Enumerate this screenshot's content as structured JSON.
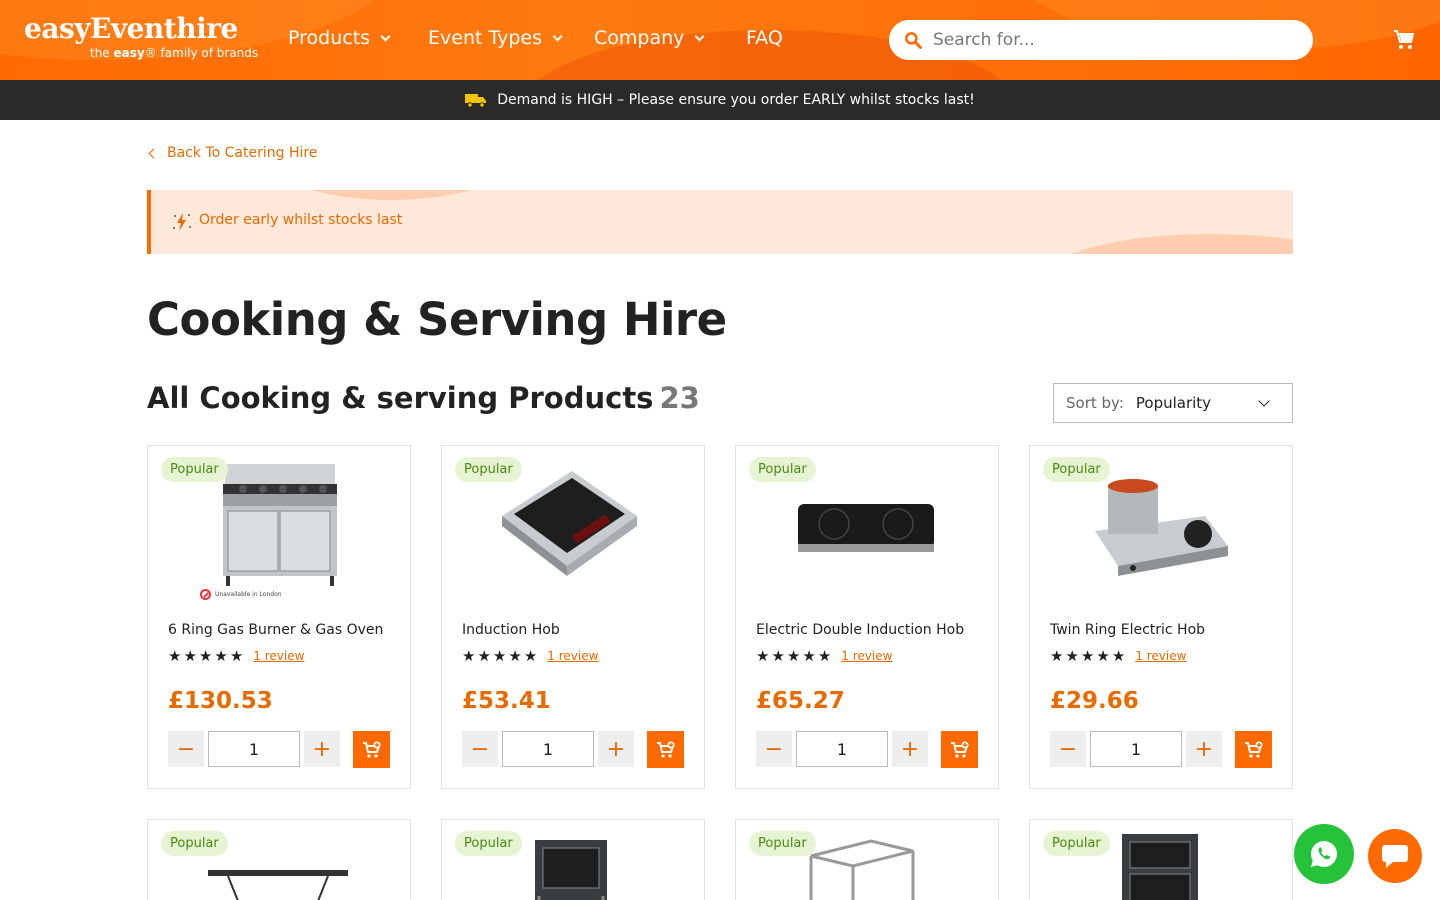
{
  "header": {
    "logo_main": "easyEventhire",
    "logo_sub_prefix": "the",
    "logo_sub_brand": "easy",
    "logo_sub_suffix": "® family of brands",
    "nav": [
      {
        "label": "Products",
        "has_dropdown": true
      },
      {
        "label": "Event Types",
        "has_dropdown": true
      },
      {
        "label": "Company",
        "has_dropdown": true
      },
      {
        "label": "FAQ",
        "has_dropdown": false
      }
    ],
    "search_placeholder": "Search for...",
    "cart_icon": "cart-icon"
  },
  "banner": {
    "text": "Demand is HIGH – Please ensure you order EARLY whilst stocks last!",
    "icon": "truck-icon"
  },
  "back_link": "Back To Catering Hire",
  "alert": {
    "text": "Order early whilst stocks last",
    "icon": "lightning-icon"
  },
  "page_title": "Cooking & Serving Hire",
  "section": {
    "title": "All Cooking & serving Products",
    "count": "23"
  },
  "sort": {
    "label": "Sort by:",
    "value": "Popularity"
  },
  "products": [
    {
      "badge": "Popular",
      "name": "6 Ring Gas Burner & Gas Oven",
      "review": "1 review",
      "price": "£130.53",
      "qty": "1",
      "note": "Unavailable in London",
      "rating": 5
    },
    {
      "badge": "Popular",
      "name": "Induction Hob",
      "review": "1 review",
      "price": "£53.41",
      "qty": "1",
      "rating": 5
    },
    {
      "badge": "Popular",
      "name": "Electric Double Induction Hob",
      "review": "1 review",
      "price": "£65.27",
      "qty": "1",
      "rating": 5
    },
    {
      "badge": "Popular",
      "name": "Twin Ring Electric Hob",
      "review": "1 review",
      "price": "£29.66",
      "qty": "1",
      "rating": 5
    },
    {
      "badge": "Popular"
    },
    {
      "badge": "Popular"
    },
    {
      "badge": "Popular"
    },
    {
      "badge": "Popular"
    }
  ],
  "colors": {
    "brand": "#ff6a00",
    "accent_text": "#e86a00",
    "badge_bg": "#e6f4d4",
    "badge_text": "#4a8a10",
    "whatsapp": "#25c33a"
  }
}
